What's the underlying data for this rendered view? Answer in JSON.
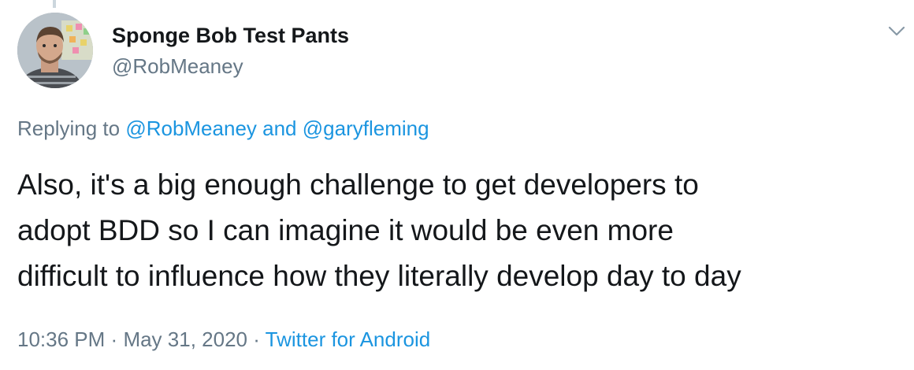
{
  "author": {
    "display_name": "Sponge Bob Test Pants",
    "handle": "@RobMeaney"
  },
  "replying": {
    "prefix": "Replying to",
    "mention_1": "@RobMeaney",
    "conjunction": "and",
    "mention_2": "@garyfleming"
  },
  "tweet": {
    "text": "Also, it's a big enough challenge to get developers to\nadopt BDD so I can imagine it would be even more\ndifficult to influence how they literally develop day to day"
  },
  "meta": {
    "time": "10:36 PM",
    "separator": "·",
    "date": "May 31, 2020",
    "source": "Twitter for Android"
  },
  "icons": {
    "menu": "chevron-down-icon"
  },
  "colors": {
    "link": "#1b95e0",
    "secondary_text": "#657786",
    "primary_text": "#14171a"
  }
}
